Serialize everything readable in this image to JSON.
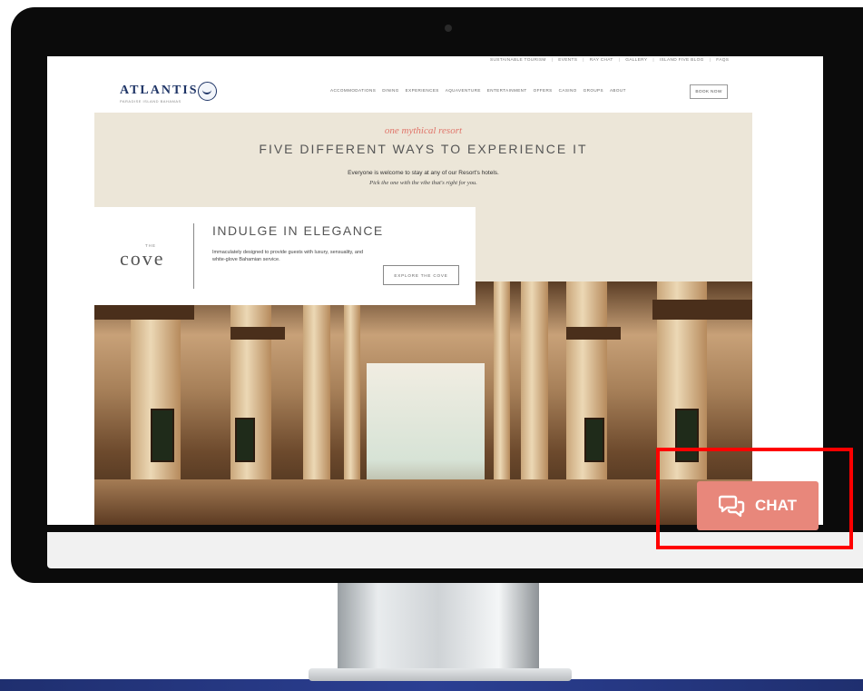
{
  "utility_nav": [
    "SUSTAINABLE TOURISM",
    "EVENTS",
    "RAY CHAT",
    "GALLERY",
    "ISLAND FIVE BLOG",
    "FAQS"
  ],
  "logo": {
    "name": "ATLANTIS",
    "subtitle": "PARADISE ISLAND BAHAMAS"
  },
  "main_nav": [
    "ACCOMMODATIONS",
    "DINING",
    "EXPERIENCES",
    "AQUAVENTURE",
    "ENTERTAINMENT",
    "OFFERS",
    "CASINO",
    "GROUPS",
    "ABOUT"
  ],
  "book_now": "BOOK NOW",
  "hero": {
    "tagline": "one mythical resort",
    "headline": "FIVE DIFFERENT WAYS TO EXPERIENCE IT",
    "intro_line1": "Everyone is welcome to stay at any of our Resort's hotels.",
    "intro_line2": "Pick the one with the vibe that's right for you."
  },
  "cove": {
    "small": "THE",
    "name": "cove",
    "heading": "INDULGE IN ELEGANCE",
    "body": "Immaculately designed to provide guests with luxury, sensuality, and white-glove Bahamian service.",
    "button": "EXPLORE THE COVE"
  },
  "chat": {
    "label": "CHAT",
    "icon": "chat-bubbles-icon",
    "color": "#e8877b"
  },
  "highlight_color": "#ff0000"
}
